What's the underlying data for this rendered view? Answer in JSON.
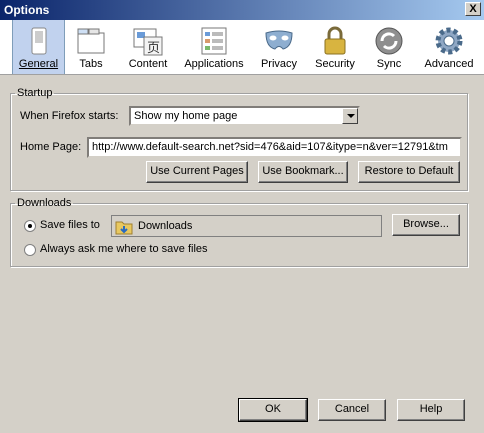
{
  "window": {
    "title": "Options",
    "close_label": "X"
  },
  "panes": [
    {
      "label": "General",
      "icon": "general-switch-icon",
      "selected": true
    },
    {
      "label": "Tabs",
      "icon": "tabs-icon",
      "selected": false
    },
    {
      "label": "Content",
      "icon": "content-icon",
      "selected": false
    },
    {
      "label": "Applications",
      "icon": "applications-icon",
      "selected": false
    },
    {
      "label": "Privacy",
      "icon": "privacy-mask-icon",
      "selected": false
    },
    {
      "label": "Security",
      "icon": "security-lock-icon",
      "selected": false
    },
    {
      "label": "Sync",
      "icon": "sync-icon",
      "selected": false
    },
    {
      "label": "Advanced",
      "icon": "advanced-gear-icon",
      "selected": false
    }
  ],
  "startup": {
    "legend": "Startup",
    "when_starts_label": "When Firefox starts:",
    "when_starts_value": "Show my home page",
    "home_page_label": "Home Page:",
    "home_page_value": "http://www.default-search.net?sid=476&aid=107&itype=n&ver=12791&tm",
    "use_current_pages": "Use Current Pages",
    "use_bookmark": "Use Bookmark...",
    "restore_default": "Restore to Default"
  },
  "downloads": {
    "legend": "Downloads",
    "save_files_to_label": "Save files to",
    "save_location": "Downloads",
    "browse_label": "Browse...",
    "always_ask_label": "Always ask me where to save files",
    "selected_option": "save_files_to"
  },
  "footer": {
    "ok": "OK",
    "cancel": "Cancel",
    "help": "Help"
  }
}
